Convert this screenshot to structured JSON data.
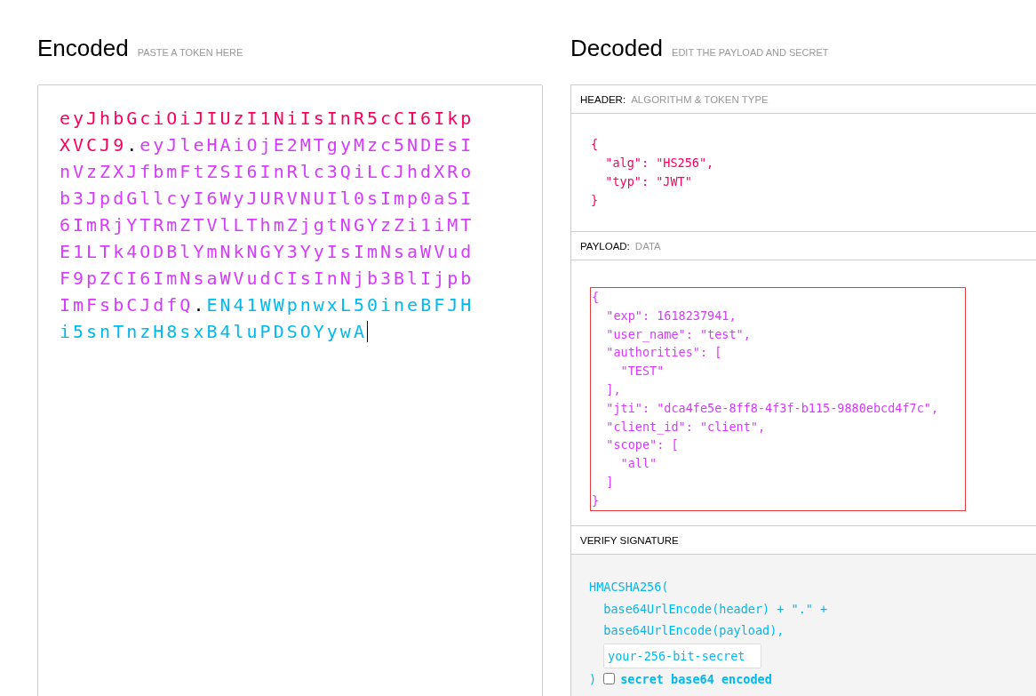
{
  "encoded": {
    "title": "Encoded",
    "hint": "PASTE A TOKEN HERE",
    "segments": [
      {
        "kind": "header",
        "text": "eyJhbGciOiJIUzI1NiIsInR5cCI6IkpXVCJ9"
      },
      {
        "kind": "dot",
        "text": "."
      },
      {
        "kind": "payload",
        "text": "eyJleHAiOjE2MTgyMzc5NDEsInVzZXJfbmFtZSI6InRlc3QiLCJhdXRob3JpdGllcyI6WyJURVNUIl0sImp0aSI6ImRjYTRmZTVlLThmZjgtNGYzZi1iMTE1LTk4ODBlYmNkNGY3YyIsImNsaWVudF9pZCI6ImNsaWVudCIsInNjb3BlIjpbImFsbCJdfQ"
      },
      {
        "kind": "dot",
        "text": "."
      },
      {
        "kind": "signature",
        "text": "EN41WWpnwxL50ineBFJHi5snTnzH8sxB4luPDSOYywA"
      }
    ]
  },
  "decoded": {
    "title": "Decoded",
    "hint": "EDIT THE PAYLOAD AND SECRET",
    "header": {
      "label": "HEADER:",
      "sublabel": "ALGORITHM & TOKEN TYPE",
      "lines": [
        "{",
        "  \"alg\": \"HS256\",",
        "  \"typ\": \"JWT\"",
        "}"
      ]
    },
    "payload": {
      "label": "PAYLOAD:",
      "sublabel": "DATA",
      "lines": [
        "{",
        "  \"exp\": 1618237941,",
        "  \"user_name\": \"test\",",
        "  \"authorities\": [",
        "    \"TEST\"",
        "  ],",
        "  \"jti\": \"dca4fe5e-8ff8-4f3f-b115-9880ebcd4f7c\",",
        "  \"client_id\": \"client\",",
        "  \"scope\": [",
        "    \"all\"",
        "  ]",
        "}"
      ]
    },
    "signature": {
      "label": "VERIFY SIGNATURE",
      "lines": [
        "HMACSHA256(",
        "  base64UrlEncode(header) + \".\" +",
        "  base64UrlEncode(payload),"
      ],
      "secret_placeholder": "your-256-bit-secret",
      "close": ")",
      "base64_label": "secret base64 encoded",
      "base64_checked": false
    }
  }
}
